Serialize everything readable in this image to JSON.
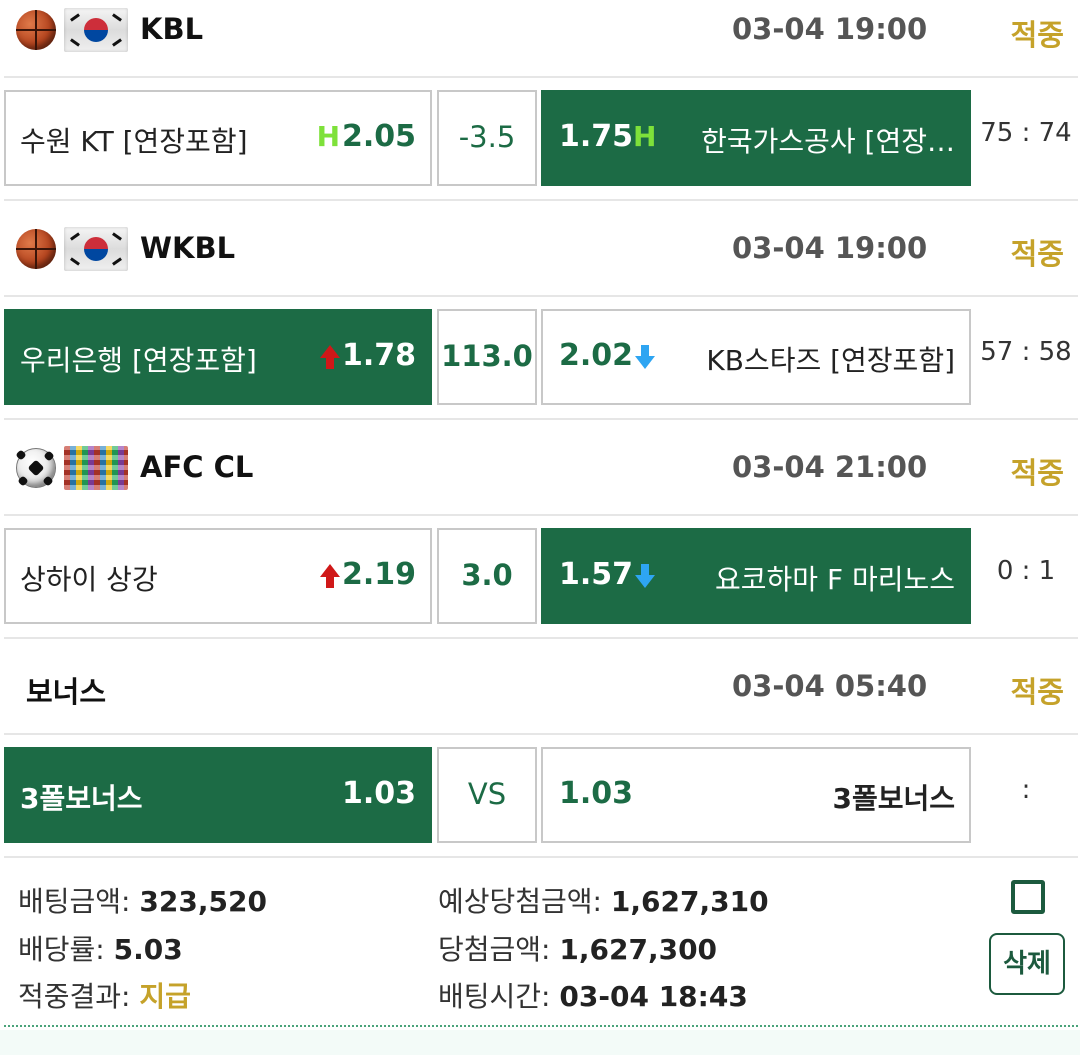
{
  "games": [
    {
      "sport_icon": "basketball-icon",
      "flag_icon": "korea-flag-icon",
      "league": "KBL",
      "datetime": "03-04 19:00",
      "status": "적중",
      "home": {
        "team": "수원 KT [연장포함]",
        "odds": "2.05",
        "indicator": "H"
      },
      "handicap": "-3.5",
      "away": {
        "team": "한국가스공사 [연장…",
        "odds": "1.75",
        "indicator": "H"
      },
      "score": "75 : 74",
      "selected": "away"
    },
    {
      "sport_icon": "basketball-icon",
      "flag_icon": "korea-flag-icon",
      "league": "WKBL",
      "datetime": "03-04 19:00",
      "status": "적중",
      "home": {
        "team": "우리은행 [연장포함]",
        "odds": "1.78",
        "indicator": "arrow-up-icon"
      },
      "handicap": "113.0",
      "away": {
        "team": "KB스타즈 [연장포함]",
        "odds": "2.02",
        "indicator": "arrow-down-icon"
      },
      "score": "57 : 58",
      "selected": "home"
    },
    {
      "sport_icon": "soccer-ball-icon",
      "flag_icon": "world-flags-icon",
      "league": "AFC CL",
      "datetime": "03-04 21:00",
      "status": "적중",
      "home": {
        "team": "상하이 상강",
        "odds": "2.19",
        "indicator": "arrow-up-icon"
      },
      "handicap": "3.0",
      "away": {
        "team": "요코하마 F 마리노스",
        "odds": "1.57",
        "indicator": "arrow-down-icon"
      },
      "score": "0 : 1",
      "selected": "away"
    },
    {
      "league": "보너스",
      "datetime": "03-04 05:40",
      "status": "적중",
      "home": {
        "team": "3폴보너스",
        "odds": "1.03"
      },
      "handicap": "VS",
      "away": {
        "team": "3폴보너스",
        "odds": "1.03"
      },
      "score": ":",
      "selected": "home"
    }
  ],
  "summary": {
    "bet_amount_label": "배팅금액:",
    "bet_amount": "323,520",
    "dividend_label": "배당률:",
    "dividend": "5.03",
    "result_label": "적중결과:",
    "result": "지급",
    "expected_label": "예상당첨금액:",
    "expected": "1,627,310",
    "winnings_label": "당첨금액:",
    "winnings": "1,627,300",
    "bet_time_label": "배팅시간:",
    "bet_time": "03-04 18:43",
    "delete_label": "삭제"
  },
  "colors": {
    "selected_bg": "#1c6b45",
    "status_gold": "#c5a22a",
    "arrow_up": "#d01818",
    "arrow_down": "#2ea5f2",
    "h_marker": "#7ee13a"
  }
}
